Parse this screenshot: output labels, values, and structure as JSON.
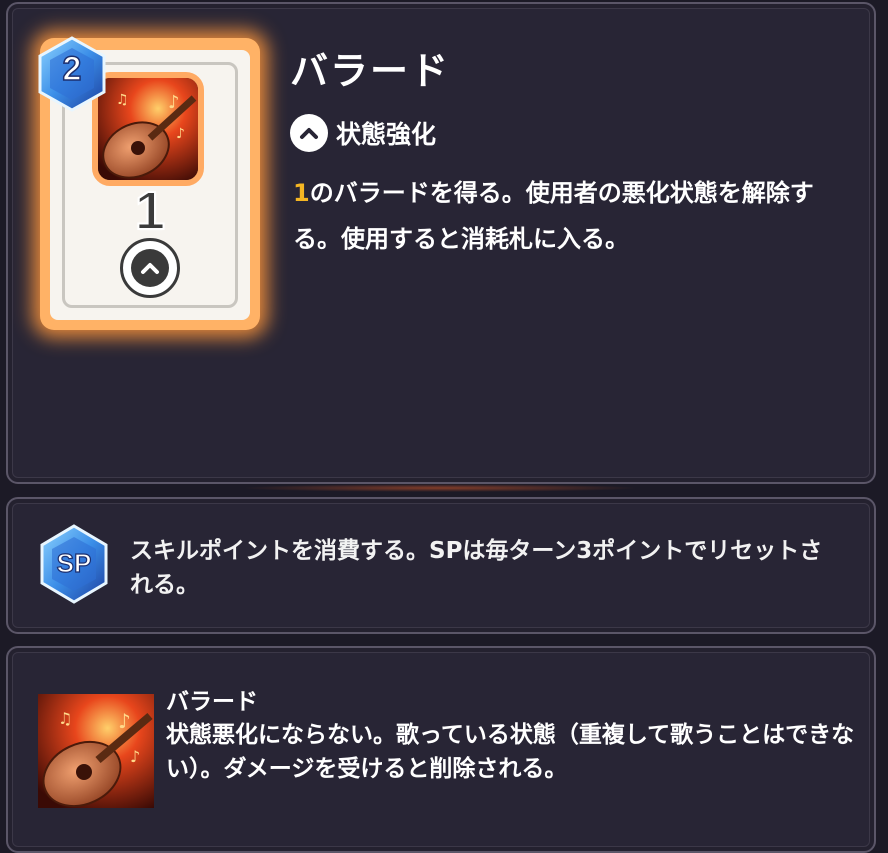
{
  "card": {
    "level": "2",
    "cost": "1",
    "title": "バラード",
    "type_label": "状態強化",
    "type_icon": "chevron-up-icon",
    "description_highlight": "1",
    "description_rest": "のバラードを得る。使用者の悪化状態を解除する。使用すると消耗札に入る。",
    "art": "lute-music-art"
  },
  "sp": {
    "icon_label": "SP",
    "description": "スキルポイントを消費する。SPは毎ターン3ポイントでリセットされる。"
  },
  "buff": {
    "name": "バラード",
    "description": "状態悪化にならない。歌っている状態（重複して歌うことはできない）。ダメージを受けると削除される。",
    "art": "lute-music-art"
  },
  "colors": {
    "panel_bg": "#282535",
    "panel_border": "#5b5668",
    "highlight": "#f5b623",
    "card_glow": "#ffb266",
    "gem_blue": "#3b8ee8"
  }
}
